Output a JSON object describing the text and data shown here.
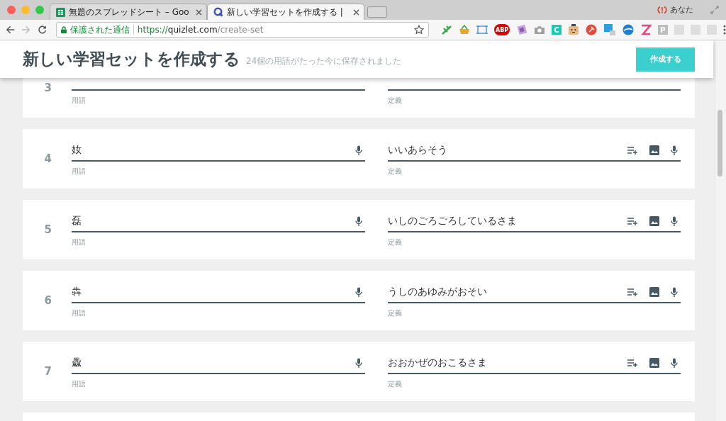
{
  "browser": {
    "tabs": [
      {
        "title": "無題のスプレッドシート – Goo",
        "kind": "sheet",
        "selected": false
      },
      {
        "title": "新しい学習セットを作成する | ",
        "kind": "quizlet",
        "selected": true
      }
    ],
    "secure_label": "保護された通信",
    "url_scheme": "https://",
    "url_host": "quizlet.com",
    "url_path": "/create-set",
    "profile": "あなた",
    "extensions": [
      {
        "kind": "leaf"
      },
      {
        "kind": "basket"
      },
      {
        "kind": "frame"
      },
      {
        "kind": "abp",
        "label": "ABP"
      },
      {
        "kind": "note"
      },
      {
        "kind": "camera"
      },
      {
        "kind": "tile",
        "label": "C",
        "color": "#1bc8b4"
      },
      {
        "kind": "face"
      },
      {
        "kind": "dot"
      },
      {
        "kind": "box"
      },
      {
        "kind": "bird"
      },
      {
        "kind": "zig"
      },
      {
        "kind": "tile",
        "label": "P",
        "color": "#bdbdbd"
      },
      {
        "kind": "faint"
      },
      {
        "kind": "faint"
      },
      {
        "kind": "faint"
      }
    ]
  },
  "header": {
    "title": "新しい学習セットを作成する",
    "status": "24個の用語がたった今に保存されました",
    "create_button": "作成する"
  },
  "cards": [
    {
      "number": "3",
      "term_label": "用語",
      "definition_label": "定義"
    },
    {
      "number": "4",
      "term": "奻",
      "term_label": "用語",
      "definition": "いいあらそう",
      "definition_label": "定義"
    },
    {
      "number": "5",
      "term": "磊",
      "term_label": "用語",
      "definition": "いしのごろごろしているさま",
      "definition_label": "定義"
    },
    {
      "number": "6",
      "term": "犇",
      "term_label": "用語",
      "definition": "うしのあゆみがおそい",
      "definition_label": "定義"
    },
    {
      "number": "7",
      "term": "飍",
      "term_label": "用語",
      "definition": "おおかぜのおこるさま",
      "definition_label": "定義"
    }
  ]
}
